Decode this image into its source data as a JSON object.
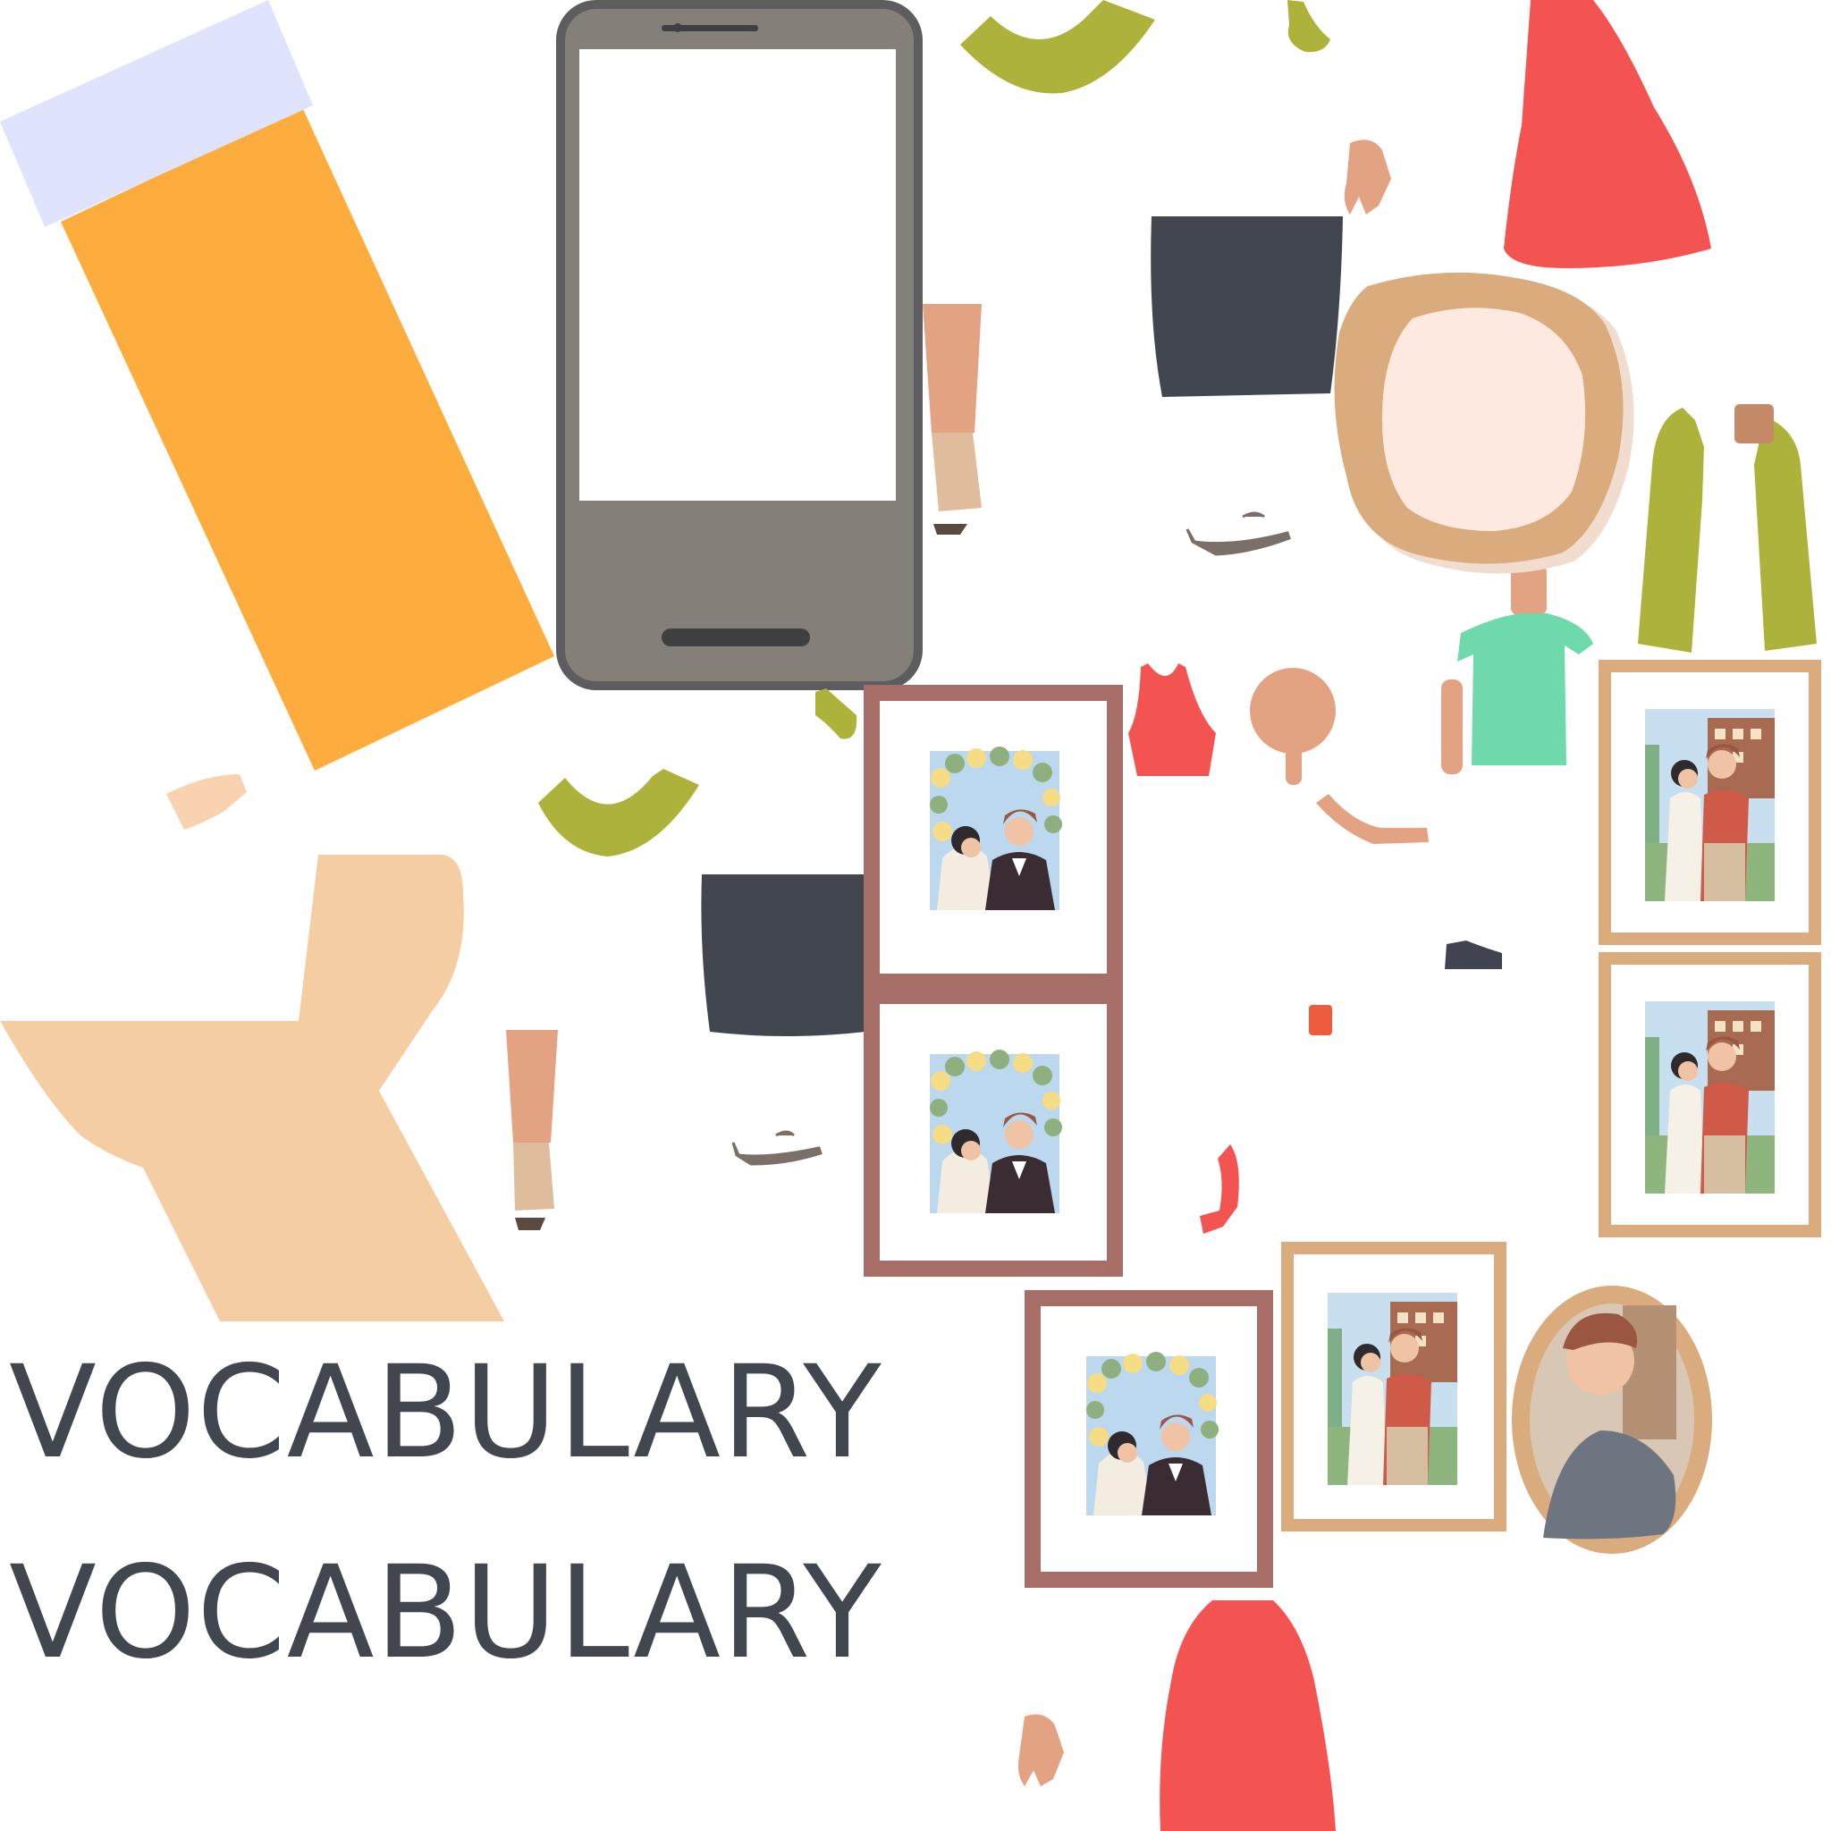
{
  "words": [
    "VOCABULARY",
    "VOCABULARY"
  ],
  "colors": {
    "text": "#42464e",
    "orange": "#fdad3d",
    "lavender": "#dfe3fc",
    "phone_body": "#848079",
    "phone_border": "#5d5d5f",
    "olive": "#adb33a",
    "coral": "#f45451",
    "skin": "#e3a282",
    "beige": "#f5cda3",
    "dark": "#42464e",
    "frame_brown": "#a66e67",
    "frame_tan": "#d9ab7d",
    "mint": "#6ed9ab"
  },
  "icons": [
    "phone-icon",
    "pencil-icon",
    "shirt-icon",
    "skirt-icon",
    "frame-icon",
    "mirror-icon",
    "toilet-icon",
    "hand-icon",
    "leg-icon",
    "shoe-icon"
  ]
}
